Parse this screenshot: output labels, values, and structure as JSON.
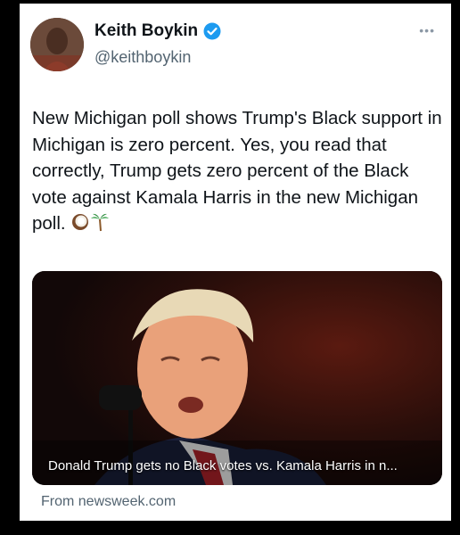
{
  "author": {
    "name": "Keith Boykin",
    "handle": "@keithboykin",
    "verified": true
  },
  "menu_icon": "more-dots-icon",
  "tweet": {
    "text": "New Michigan poll shows Trump's Black support in Michigan is zero percent. Yes, you read that correctly, Trump gets zero percent of the Black vote against Kamala Harris in the new Michigan poll.",
    "emojis": [
      "coconut-icon",
      "palm-tree-icon"
    ]
  },
  "link_card": {
    "headline": "Donald Trump gets no Black votes vs. Kamala Harris in n...",
    "source": "From newsweek.com"
  },
  "colors": {
    "background": "#000000",
    "card": "#ffffff",
    "text": "#0f1419",
    "secondary": "#536471",
    "verified": "#1d9bf0"
  }
}
